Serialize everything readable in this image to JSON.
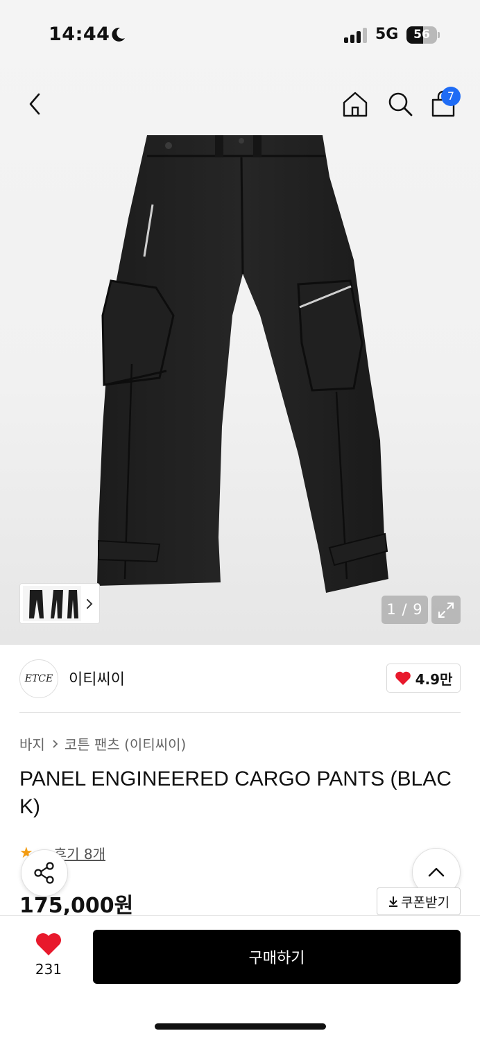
{
  "status_bar": {
    "time": "14:44",
    "network": "5G",
    "battery": "56"
  },
  "header": {
    "cart_count": "7"
  },
  "gallery": {
    "counter": "1 / 9"
  },
  "brand": {
    "logo_text": "ETCE",
    "name": "이티씨이",
    "likes": "4.9만",
    "like_color": "#e8192c"
  },
  "breadcrumb": {
    "category": "바지",
    "subcategory": "코튼 팬츠 (이티씨이)"
  },
  "product": {
    "title": "PANEL ENGINEERED CARGO PANTS (BLACK)",
    "reviews": "후기 8개",
    "price": "175,000원"
  },
  "coupon": {
    "label": "쿠폰받기"
  },
  "bottom_bar": {
    "wish_count": "231",
    "buy_label": "구매하기"
  }
}
